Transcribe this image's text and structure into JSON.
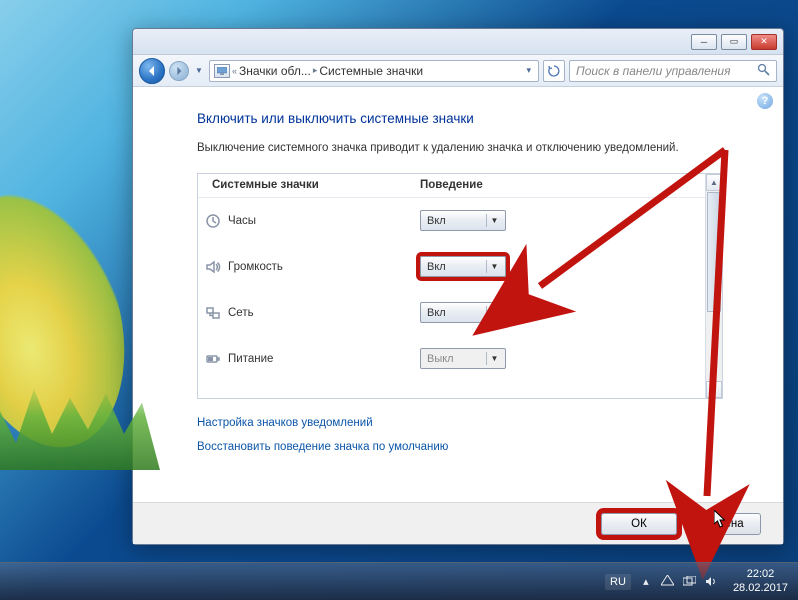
{
  "breadcrumb": {
    "seg1": "Значки обл...",
    "seg2": "Системные значки"
  },
  "search_placeholder": "Поиск в панели управления",
  "heading": "Включить или выключить системные значки",
  "description": "Выключение системного значка приводит к удалению значка и отключению уведомлений.",
  "columns": {
    "name": "Системные значки",
    "behavior": "Поведение"
  },
  "rows": [
    {
      "icon": "clock",
      "label": "Часы",
      "value": "Вкл",
      "disabled": false,
      "highlight": false
    },
    {
      "icon": "volume",
      "label": "Громкость",
      "value": "Вкл",
      "disabled": false,
      "highlight": true
    },
    {
      "icon": "network",
      "label": "Сеть",
      "value": "Вкл",
      "disabled": false,
      "highlight": false
    },
    {
      "icon": "power",
      "label": "Питание",
      "value": "Выкл",
      "disabled": true,
      "highlight": false
    }
  ],
  "links": {
    "customize": "Настройка значков уведомлений",
    "restore": "Восстановить поведение значка по умолчанию"
  },
  "buttons": {
    "ok": "ОК",
    "cancel": "Отмена"
  },
  "tray": {
    "lang": "RU",
    "time": "22:02",
    "date": "28.02.2017"
  },
  "colors": {
    "highlight": "#c2140f",
    "link": "#0a55a9",
    "heading": "#003399"
  }
}
